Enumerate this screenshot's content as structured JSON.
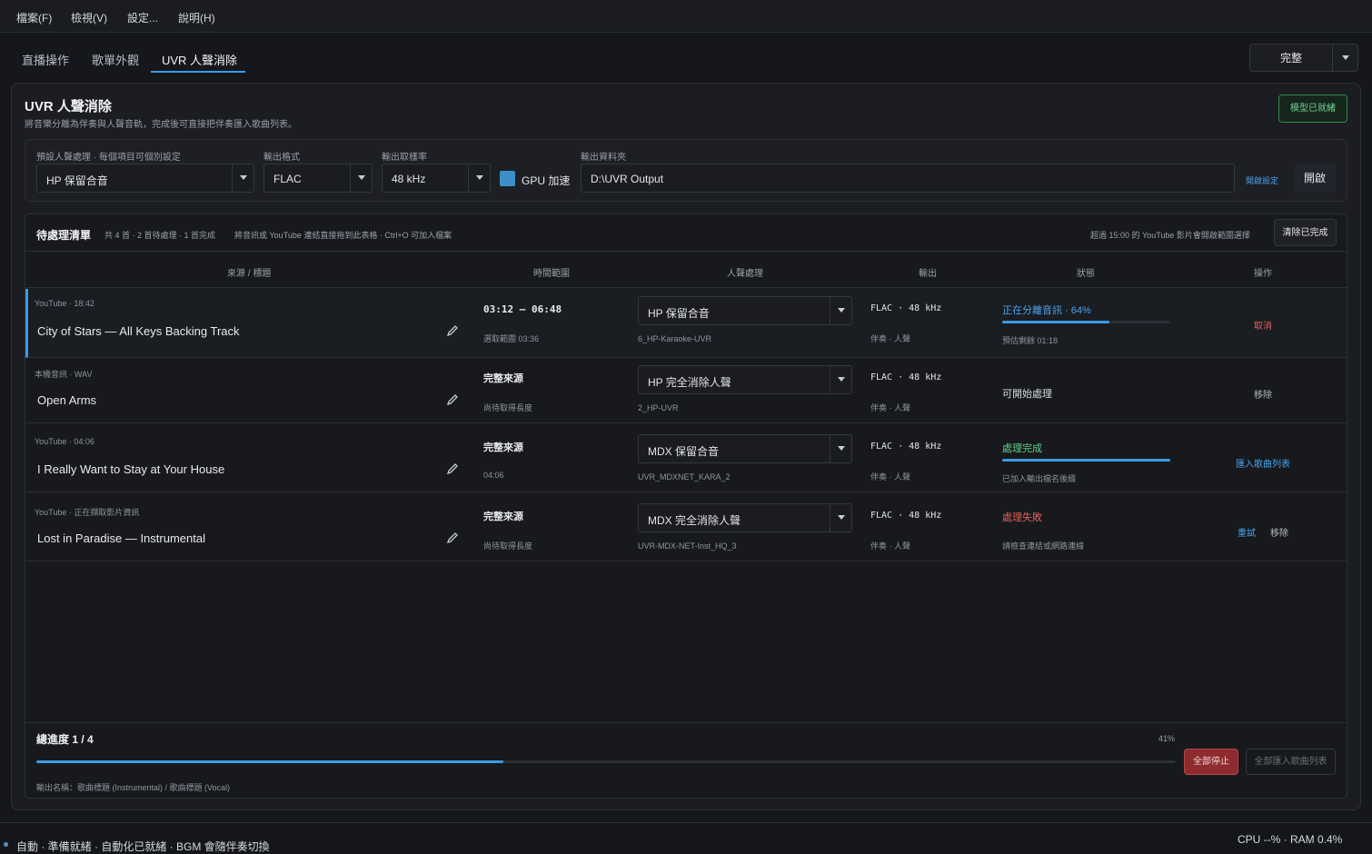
{
  "menu": [
    "檔案(F)",
    "檢視(V)",
    "設定...",
    "說明(H)"
  ],
  "tabs": [
    "直播操作",
    "歌單外觀",
    "UVR 人聲消除"
  ],
  "mode_button": "完整",
  "panel": {
    "title": "UVR 人聲消除",
    "subtitle": "將音樂分離為伴奏與人聲音軌，完成後可直接把伴奏匯入歌曲列表。",
    "model_status": "模型已就緒"
  },
  "settings": {
    "preset_label": "預設人聲處理 · 每個項目可個別設定",
    "preset_value": "HP 保留合音",
    "format_label": "輸出格式",
    "format_value": "FLAC",
    "rate_label": "輸出取樣率",
    "rate_value": "48 kHz",
    "gpu_label": "GPU 加速",
    "gpu_checked": true,
    "folder_label": "輸出資料夾",
    "folder_value": "D:\\UVR Output",
    "advanced_link": "開啟設定",
    "open_button": "開啟"
  },
  "queue": {
    "title": "待處理清單",
    "summary": "共 4 首 · 2 首待處理 · 1 首完成",
    "hint": "將音訊或 YouTube 連結直接拖到此表格 · Ctrl+O 可加入檔案",
    "notice": "超過 15:00 的 YouTube 影片會開啟範圍選擇",
    "clear_button": "清除已完成",
    "columns": [
      "來源 / 標題",
      "時間範圍",
      "人聲處理",
      "輸出",
      "狀態",
      "操作"
    ],
    "rows": [
      {
        "meta": "YouTube · 18:42",
        "title": "City of Stars — All Keys Backing Track",
        "range": "03:12 – 06:48",
        "range_sub": "選取範圍 03:36",
        "process": "HP 保留合音",
        "model": "6_HP-Karaoke-UVR",
        "output": "FLAC · 48 kHz",
        "output_sub": "伴奏 · 人聲",
        "status": "正在分離音訊 · 64%",
        "status_color": "#4aa3ec",
        "progress": 0.64,
        "status_sub": "預估剩餘 01:18",
        "actions": [
          "取消"
        ]
      },
      {
        "meta": "本機音訊 · WAV",
        "title": "Open Arms",
        "range": "完整來源",
        "range_sub": "尚待取得長度",
        "process": "HP 完全消除人聲",
        "model": "2_HP-UVR",
        "output": "FLAC · 48 kHz",
        "output_sub": "伴奏 · 人聲",
        "status": "可開始處理",
        "status_color": "#d6d9de",
        "status_sub": "",
        "actions": [
          "移除"
        ]
      },
      {
        "meta": "YouTube · 04:06",
        "title": "I Really Want to Stay at Your House",
        "range": "完整來源",
        "range_sub": "04:06",
        "process": "MDX 保留合音",
        "model": "UVR_MDXNET_KARA_2",
        "output": "FLAC · 48 kHz",
        "output_sub": "伴奏 · 人聲",
        "status": "處理完成",
        "status_color": "#5fcf84",
        "progress": 1.0,
        "status_sub": "已加入輸出檔名後綴",
        "actions": [
          "匯入歌曲列表"
        ]
      },
      {
        "meta": "YouTube · 正在擷取影片資訊",
        "title": "Lost in Paradise — Instrumental",
        "range": "完整來源",
        "range_sub": "尚待取得長度",
        "process": "MDX 完全消除人聲",
        "model": "UVR-MDX-NET-Inst_HQ_3",
        "output": "FLAC · 48 kHz",
        "output_sub": "伴奏 · 人聲",
        "status": "處理失敗",
        "status_color": "#e0605a",
        "status_sub": "請檢查連結或網路連線",
        "actions": [
          "重試",
          "移除"
        ]
      }
    ]
  },
  "footer": {
    "progress_label": "總進度 1 / 4",
    "percent_text": "41%",
    "progress": 0.41,
    "naming": "輸出名稱：歌曲標題 (Instrumental) / 歌曲標題 (Vocal)",
    "stop_button": "全部停止",
    "import_all_button": "全部匯入歌曲列表"
  },
  "statusbar": {
    "left": "自動 · 準備就緒 · 自動化已就緒 · BGM 會隨伴奏切換",
    "right": "CPU --% · RAM 0.4%"
  }
}
